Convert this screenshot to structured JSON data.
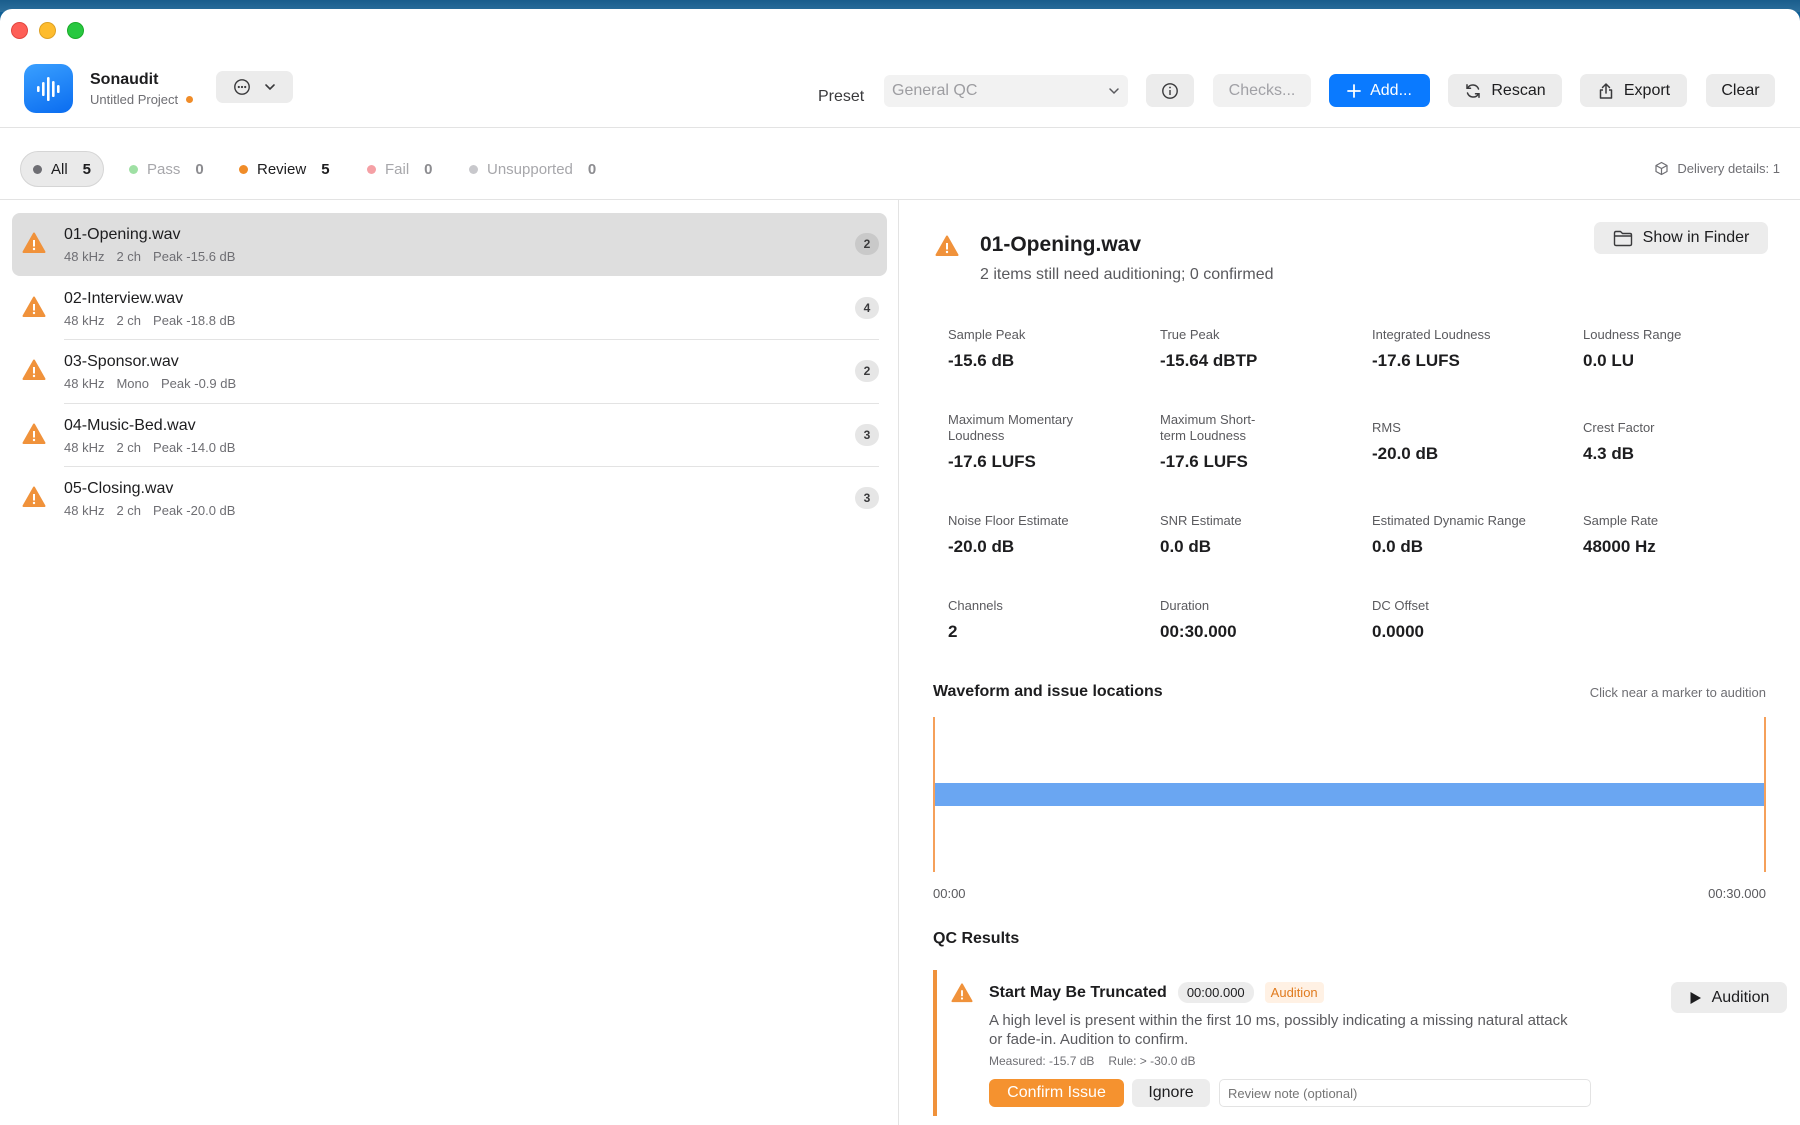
{
  "app": {
    "name": "Sonaudit",
    "project": "Untitled Project"
  },
  "toolbar": {
    "preset_label": "Preset",
    "preset_value": "General QC",
    "checks_label": "Checks...",
    "add_label": "Add...",
    "rescan_label": "Rescan",
    "export_label": "Export",
    "clear_label": "Clear"
  },
  "filters": [
    {
      "label": "All",
      "count": "5",
      "color": "#6e6e73"
    },
    {
      "label": "Pass",
      "count": "0",
      "color": "#9fe0a4"
    },
    {
      "label": "Review",
      "count": "5",
      "color": "#f08c28"
    },
    {
      "label": "Fail",
      "count": "0",
      "color": "#f5a0a5"
    },
    {
      "label": "Unsupported",
      "count": "0",
      "color": "#c8c8cc"
    }
  ],
  "delivery": "Delivery details: 1",
  "files": [
    {
      "name": "01-Opening.wav",
      "rate": "48 kHz",
      "channels": "2 ch",
      "peak": "Peak -15.6 dB",
      "issues": "2"
    },
    {
      "name": "02-Interview.wav",
      "rate": "48 kHz",
      "channels": "2 ch",
      "peak": "Peak -18.8 dB",
      "issues": "4"
    },
    {
      "name": "03-Sponsor.wav",
      "rate": "48 kHz",
      "channels": "Mono",
      "peak": "Peak -0.9 dB",
      "issues": "2"
    },
    {
      "name": "04-Music-Bed.wav",
      "rate": "48 kHz",
      "channels": "2 ch",
      "peak": "Peak -14.0 dB",
      "issues": "3"
    },
    {
      "name": "05-Closing.wav",
      "rate": "48 kHz",
      "channels": "2 ch",
      "peak": "Peak -20.0 dB",
      "issues": "3"
    }
  ],
  "detail": {
    "title": "01-Opening.wav",
    "subtitle": "2 items still need auditioning; 0 confirmed",
    "finder_label": "Show in Finder",
    "metrics": [
      {
        "label": "Sample Peak",
        "value": "-15.6 dB"
      },
      {
        "label": "True Peak",
        "value": "-15.64 dBTP"
      },
      {
        "label": "Integrated Loudness",
        "value": "-17.6 LUFS"
      },
      {
        "label": "Loudness Range",
        "value": "0.0 LU"
      },
      {
        "label": "Maximum Momentary Loudness",
        "value": "-17.6 LUFS"
      },
      {
        "label": "Maximum Short-term Loudness",
        "value": "-17.6 LUFS"
      },
      {
        "label": "RMS",
        "value": "-20.0 dB"
      },
      {
        "label": "Crest Factor",
        "value": "4.3 dB"
      },
      {
        "label": "Noise Floor Estimate",
        "value": "-20.0 dB"
      },
      {
        "label": "SNR Estimate",
        "value": "0.0 dB"
      },
      {
        "label": "Estimated Dynamic Range",
        "value": "0.0 dB"
      },
      {
        "label": "Sample Rate",
        "value": "48000 Hz"
      },
      {
        "label": "Channels",
        "value": "2"
      },
      {
        "label": "Duration",
        "value": "00:30.000"
      },
      {
        "label": "DC Offset",
        "value": "0.0000"
      }
    ],
    "waveform": {
      "title": "Waveform and issue locations",
      "hint": "Click near a marker to audition",
      "start": "00:00",
      "end": "00:30.000",
      "band_color": "#6aa6f2",
      "marker_color": "#f5a05a"
    },
    "qc_title": "QC Results",
    "issue": {
      "title": "Start May Be Truncated",
      "time": "00:00.000",
      "tag": "Audition",
      "description": "A high level is present within the first 10 ms, possibly indicating a missing natural attack or fade-in. Audition to confirm.",
      "measured": "Measured: -15.7 dB",
      "rule": "Rule: > -30.0 dB",
      "confirm_label": "Confirm Issue",
      "ignore_label": "Ignore",
      "note_placeholder": "Review note (optional)",
      "audition_label": "Audition"
    }
  }
}
